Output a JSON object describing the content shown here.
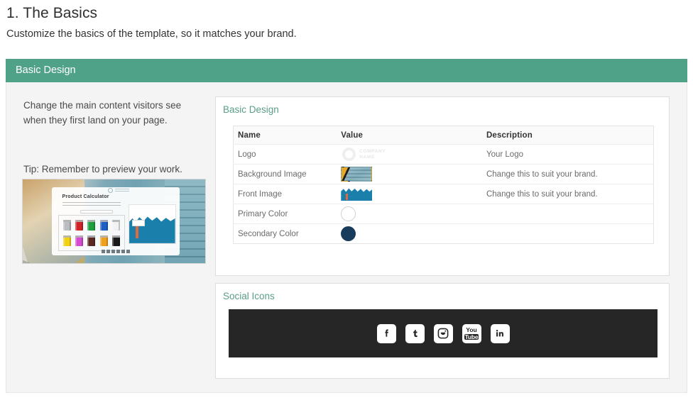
{
  "page": {
    "title": "1. The Basics",
    "subtitle": "Customize the basics of the template, so it matches your brand."
  },
  "section": {
    "header_label": "Basic Design",
    "header_color": "#4fa187"
  },
  "help": {
    "description": "Change the main content visitors see when they first land on your page.",
    "tip": "Tip: Remember to preview your work.",
    "preview": {
      "heading": "Product Calculator"
    }
  },
  "basic_design_panel": {
    "title": "Basic Design",
    "table": {
      "columns": [
        "Name",
        "Value",
        "Description"
      ],
      "rows": [
        {
          "name": "Logo",
          "value_type": "logo-thumbnail",
          "value_text": "COMPANY NAME",
          "description": "Your Logo"
        },
        {
          "name": "Background Image",
          "value_type": "image-thumbnail",
          "value_text": "",
          "description": "Change this to suit your brand."
        },
        {
          "name": "Front Image",
          "value_type": "image-thumbnail",
          "value_text": "",
          "description": "Change this to suit your brand."
        },
        {
          "name": "Primary Color",
          "value_type": "color-swatch",
          "value_color": "#ffffff",
          "description": ""
        },
        {
          "name": "Secondary Color",
          "value_type": "color-swatch",
          "value_color": "#173b5b",
          "description": ""
        }
      ]
    }
  },
  "social_panel": {
    "title": "Social Icons",
    "strip_color": "#262626",
    "icons": [
      {
        "name": "facebook-icon",
        "label": "Facebook"
      },
      {
        "name": "tumblr-icon",
        "label": "Tumblr"
      },
      {
        "name": "instagram-icon",
        "label": "Instagram"
      },
      {
        "name": "youtube-icon",
        "label": "YouTube",
        "line1": "You",
        "line2": "Tube"
      },
      {
        "name": "linkedin-icon",
        "label": "LinkedIn"
      }
    ]
  }
}
